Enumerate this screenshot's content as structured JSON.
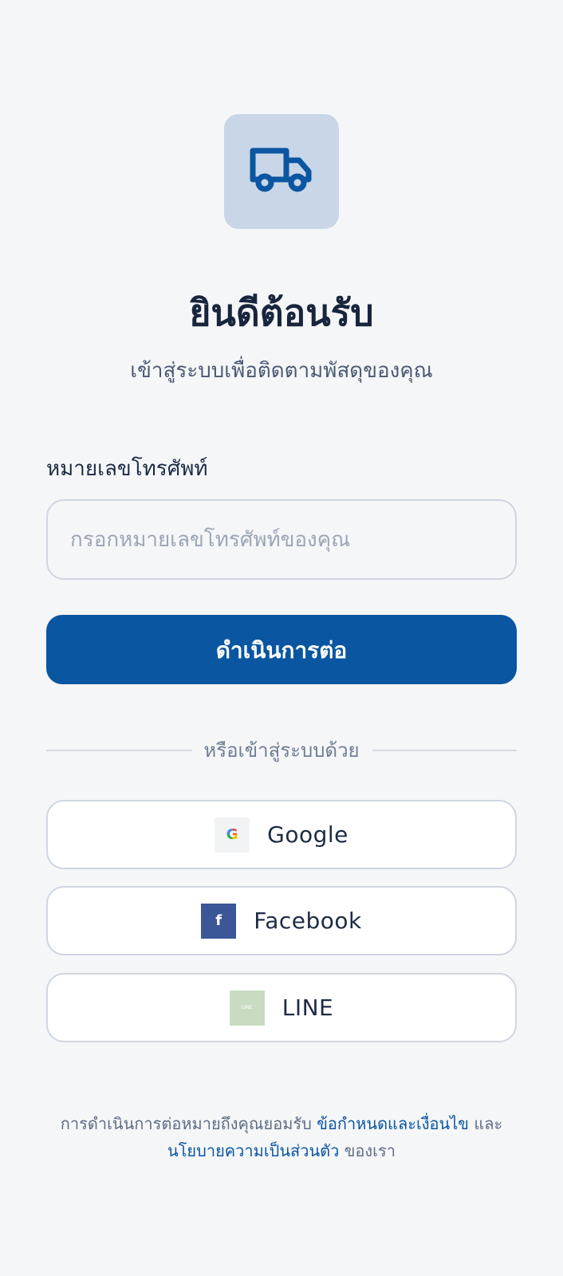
{
  "header": {
    "logo_icon": "truck-icon",
    "title": "ยินดีต้อนรับ",
    "subtitle": "เข้าสู่ระบบเพื่อติดตามพัสดุของคุณ"
  },
  "form": {
    "phone_label": "หมายเลขโทรศัพท์",
    "phone_value": "",
    "phone_placeholder": "กรอกหมายเลขโทรศัพท์ของคุณ",
    "continue_label": "ดำเนินการต่อ"
  },
  "divider": {
    "text": "หรือเข้าสู่ระบบด้วย"
  },
  "social": {
    "google": {
      "icon": "google-icon",
      "icon_text": "G",
      "label": "Google"
    },
    "facebook": {
      "icon": "facebook-icon",
      "icon_text": "f",
      "label": "Facebook"
    },
    "line": {
      "icon": "line-icon",
      "icon_text": "LINE",
      "label": "LINE"
    }
  },
  "legal": {
    "prefix": "การดำเนินการต่อหมายถึงคุณยอมรับ",
    "terms_link": "ข้อกำหนดและเงื่อนไข",
    "conjunction": "และ",
    "privacy_link": "นโยบายความเป็นส่วนตัว",
    "suffix": "ของเรา"
  },
  "colors": {
    "background": "#f5f6f8",
    "primary": "#0a56a1",
    "logo_bg": "#c8d6e7",
    "facebook": "#3b5798",
    "line": "#c9dbc3"
  }
}
